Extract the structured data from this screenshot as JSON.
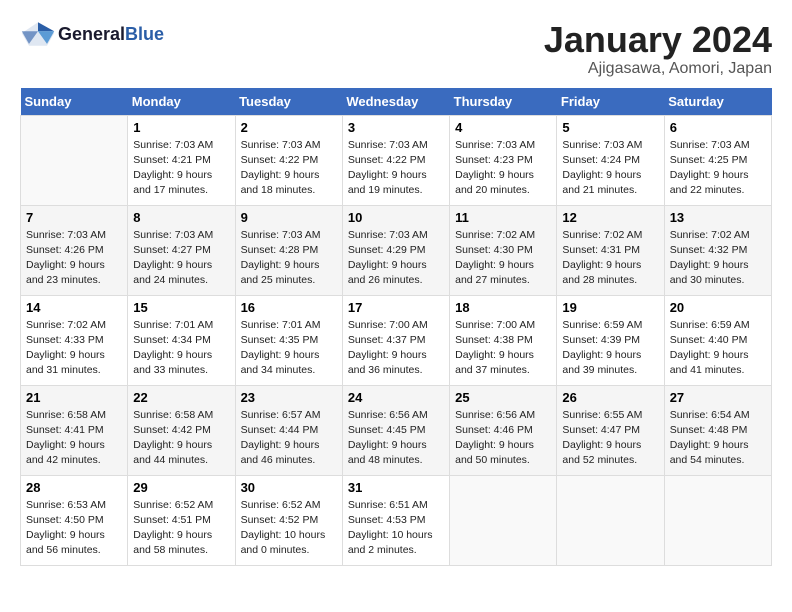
{
  "header": {
    "logo_general": "General",
    "logo_blue": "Blue",
    "month_title": "January 2024",
    "location": "Ajigasawa, Aomori, Japan"
  },
  "days_of_week": [
    "Sunday",
    "Monday",
    "Tuesday",
    "Wednesday",
    "Thursday",
    "Friday",
    "Saturday"
  ],
  "weeks": [
    [
      {
        "day": null
      },
      {
        "day": "1",
        "sunrise": "7:03 AM",
        "sunset": "4:21 PM",
        "daylight": "9 hours and 17 minutes."
      },
      {
        "day": "2",
        "sunrise": "7:03 AM",
        "sunset": "4:22 PM",
        "daylight": "9 hours and 18 minutes."
      },
      {
        "day": "3",
        "sunrise": "7:03 AM",
        "sunset": "4:22 PM",
        "daylight": "9 hours and 19 minutes."
      },
      {
        "day": "4",
        "sunrise": "7:03 AM",
        "sunset": "4:23 PM",
        "daylight": "9 hours and 20 minutes."
      },
      {
        "day": "5",
        "sunrise": "7:03 AM",
        "sunset": "4:24 PM",
        "daylight": "9 hours and 21 minutes."
      },
      {
        "day": "6",
        "sunrise": "7:03 AM",
        "sunset": "4:25 PM",
        "daylight": "9 hours and 22 minutes."
      }
    ],
    [
      {
        "day": "7",
        "sunrise": "7:03 AM",
        "sunset": "4:26 PM",
        "daylight": "9 hours and 23 minutes."
      },
      {
        "day": "8",
        "sunrise": "7:03 AM",
        "sunset": "4:27 PM",
        "daylight": "9 hours and 24 minutes."
      },
      {
        "day": "9",
        "sunrise": "7:03 AM",
        "sunset": "4:28 PM",
        "daylight": "9 hours and 25 minutes."
      },
      {
        "day": "10",
        "sunrise": "7:03 AM",
        "sunset": "4:29 PM",
        "daylight": "9 hours and 26 minutes."
      },
      {
        "day": "11",
        "sunrise": "7:02 AM",
        "sunset": "4:30 PM",
        "daylight": "9 hours and 27 minutes."
      },
      {
        "day": "12",
        "sunrise": "7:02 AM",
        "sunset": "4:31 PM",
        "daylight": "9 hours and 28 minutes."
      },
      {
        "day": "13",
        "sunrise": "7:02 AM",
        "sunset": "4:32 PM",
        "daylight": "9 hours and 30 minutes."
      }
    ],
    [
      {
        "day": "14",
        "sunrise": "7:02 AM",
        "sunset": "4:33 PM",
        "daylight": "9 hours and 31 minutes."
      },
      {
        "day": "15",
        "sunrise": "7:01 AM",
        "sunset": "4:34 PM",
        "daylight": "9 hours and 33 minutes."
      },
      {
        "day": "16",
        "sunrise": "7:01 AM",
        "sunset": "4:35 PM",
        "daylight": "9 hours and 34 minutes."
      },
      {
        "day": "17",
        "sunrise": "7:00 AM",
        "sunset": "4:37 PM",
        "daylight": "9 hours and 36 minutes."
      },
      {
        "day": "18",
        "sunrise": "7:00 AM",
        "sunset": "4:38 PM",
        "daylight": "9 hours and 37 minutes."
      },
      {
        "day": "19",
        "sunrise": "6:59 AM",
        "sunset": "4:39 PM",
        "daylight": "9 hours and 39 minutes."
      },
      {
        "day": "20",
        "sunrise": "6:59 AM",
        "sunset": "4:40 PM",
        "daylight": "9 hours and 41 minutes."
      }
    ],
    [
      {
        "day": "21",
        "sunrise": "6:58 AM",
        "sunset": "4:41 PM",
        "daylight": "9 hours and 42 minutes."
      },
      {
        "day": "22",
        "sunrise": "6:58 AM",
        "sunset": "4:42 PM",
        "daylight": "9 hours and 44 minutes."
      },
      {
        "day": "23",
        "sunrise": "6:57 AM",
        "sunset": "4:44 PM",
        "daylight": "9 hours and 46 minutes."
      },
      {
        "day": "24",
        "sunrise": "6:56 AM",
        "sunset": "4:45 PM",
        "daylight": "9 hours and 48 minutes."
      },
      {
        "day": "25",
        "sunrise": "6:56 AM",
        "sunset": "4:46 PM",
        "daylight": "9 hours and 50 minutes."
      },
      {
        "day": "26",
        "sunrise": "6:55 AM",
        "sunset": "4:47 PM",
        "daylight": "9 hours and 52 minutes."
      },
      {
        "day": "27",
        "sunrise": "6:54 AM",
        "sunset": "4:48 PM",
        "daylight": "9 hours and 54 minutes."
      }
    ],
    [
      {
        "day": "28",
        "sunrise": "6:53 AM",
        "sunset": "4:50 PM",
        "daylight": "9 hours and 56 minutes."
      },
      {
        "day": "29",
        "sunrise": "6:52 AM",
        "sunset": "4:51 PM",
        "daylight": "9 hours and 58 minutes."
      },
      {
        "day": "30",
        "sunrise": "6:52 AM",
        "sunset": "4:52 PM",
        "daylight": "10 hours and 0 minutes."
      },
      {
        "day": "31",
        "sunrise": "6:51 AM",
        "sunset": "4:53 PM",
        "daylight": "10 hours and 2 minutes."
      },
      {
        "day": null
      },
      {
        "day": null
      },
      {
        "day": null
      }
    ]
  ]
}
